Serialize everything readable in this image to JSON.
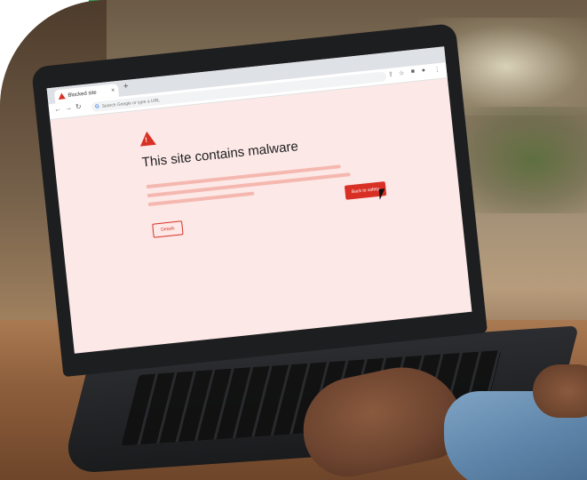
{
  "browser": {
    "tab_title": "Blocked site",
    "tab_close": "×",
    "new_tab": "+",
    "omnibox_placeholder": "Search Google or type a URL",
    "google_glyph": "G"
  },
  "warning_page": {
    "headline": "This site contains malware",
    "details_label": "Details",
    "back_label": "Back to safety"
  },
  "colors": {
    "accent_green": "#34a853",
    "warning_red": "#d93025",
    "page_background": "#fce8e6"
  },
  "icons": [
    "warning-triangle-icon",
    "back-arrow-icon",
    "forward-arrow-icon",
    "reload-icon",
    "share-icon",
    "star-icon",
    "extensions-icon",
    "profile-icon",
    "menu-icon",
    "mouse-cursor-icon"
  ]
}
